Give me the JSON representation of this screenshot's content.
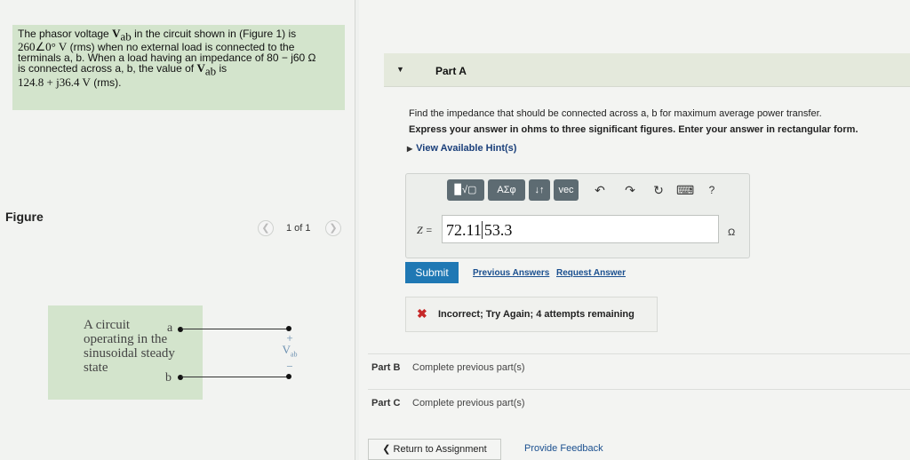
{
  "problem": {
    "line1_prefix": "The phasor voltage ",
    "line1_var": "V",
    "line1_sub": "ab",
    "line1_suffix": " in the circuit shown in (Figure 1) is",
    "line2_value": "260∠0°  V",
    "line2_suffix": " (rms) when no external load is connected to the",
    "line3": "terminals a, b. When a load having an impedance of 80 − j60 Ω",
    "line4_prefix": "is connected across a, b, the value of ",
    "line4_var": "V",
    "line4_sub": "ab",
    "line4_suffix": " is",
    "line5_value": "124.8 + j36.4 V",
    "line5_suffix": " (rms)."
  },
  "figure": {
    "label": "Figure",
    "counter": "1 of 1",
    "prev_icon": "chevron-left-icon",
    "next_icon": "chevron-right-icon",
    "circuit_text": "A circuit operating in the sinusoidal steady state",
    "terminal_a": "a",
    "terminal_b": "b",
    "plus_sign": "+",
    "minus_sign": "−",
    "vab_var": "V",
    "vab_sub": "ab"
  },
  "part_a": {
    "title": "Part A",
    "question": "Find the impedance that should be connected across a, b for maximum average power transfer.",
    "instruction": "Express your answer in ohms to three significant figures. Enter your answer in rectangular form.",
    "hint_link": "View Available Hint(s)"
  },
  "toolbar": {
    "templates_label": "▉√▢",
    "greek_label": "ΑΣφ",
    "updown_label": "↓↑",
    "vec_label": "vec",
    "undo_icon": "↶",
    "redo_icon": "↷",
    "reset_icon": "↻",
    "keyboard_icon": "⌨",
    "help_icon": "?"
  },
  "answer": {
    "label": "Z =",
    "magnitude": "72.11",
    "angle": "53.3",
    "unit": "Ω"
  },
  "actions": {
    "submit": "Submit",
    "previous_answers": "Previous Answers",
    "request_answer": "Request Answer"
  },
  "feedback": {
    "icon": "✖",
    "text": "Incorrect; Try Again; 4 attempts remaining"
  },
  "other_parts": [
    {
      "name": "Part B",
      "status": "Complete previous part(s)"
    },
    {
      "name": "Part C",
      "status": "Complete previous part(s)"
    }
  ],
  "footer": {
    "return": "❮ Return to Assignment",
    "provide_feedback": "Provide Feedback"
  },
  "colors": {
    "problem_bg": "#d3e4cc",
    "submit_bg": "#1f78b4",
    "incorrect": "#c62828",
    "link": "#1a4f8f"
  }
}
